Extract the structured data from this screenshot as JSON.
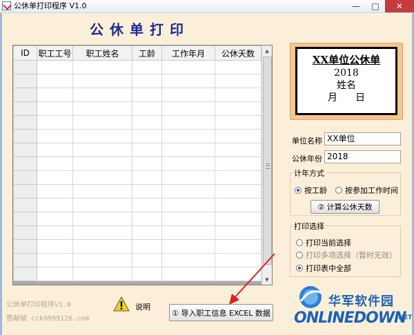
{
  "window": {
    "title": "公休单打印程序 V1.0",
    "buttons": {
      "minimize": "—",
      "maximize": "□",
      "close": "✕"
    }
  },
  "main": {
    "title": "公休单打印",
    "grid": {
      "columns": [
        "ID",
        "职工工号",
        "职工姓名",
        "工龄",
        "工作年月",
        "公休天数"
      ],
      "row_count": 16
    }
  },
  "preview": {
    "title": "XX单位公休单",
    "year": "2018",
    "name": "姓名",
    "month": "月",
    "day": "日"
  },
  "form": {
    "unit_label": "单位名称",
    "unit_value": "XX单位",
    "year_label": "公休年份",
    "year_value": "2018"
  },
  "calc": {
    "group_title": "计年方式",
    "by_seniority": "按工龄",
    "by_join_date": "按参加工作时间",
    "selected": "by_seniority",
    "calc_button": "② 计算公休天数"
  },
  "print": {
    "group_title": "打印选择",
    "current": "打印当前选择",
    "multi": "打印多项选择（暂时无效）",
    "all": "打印表中全部",
    "selected": "all"
  },
  "footer": {
    "program": "公休单打印程序V1.0",
    "author": "蔷献破 cck9999126.com",
    "help_label": "说明",
    "import_button": "① 导入职工信息 EXCEL 数据"
  },
  "watermark": {
    "cn": "华军软件园",
    "en": "ONLINEDOWN",
    "suffix": ".NET"
  },
  "colors": {
    "background": "#fcefd9",
    "title": "#1c2b94",
    "preview_frame": "#f7c68d",
    "logo": "#1d62b8"
  }
}
